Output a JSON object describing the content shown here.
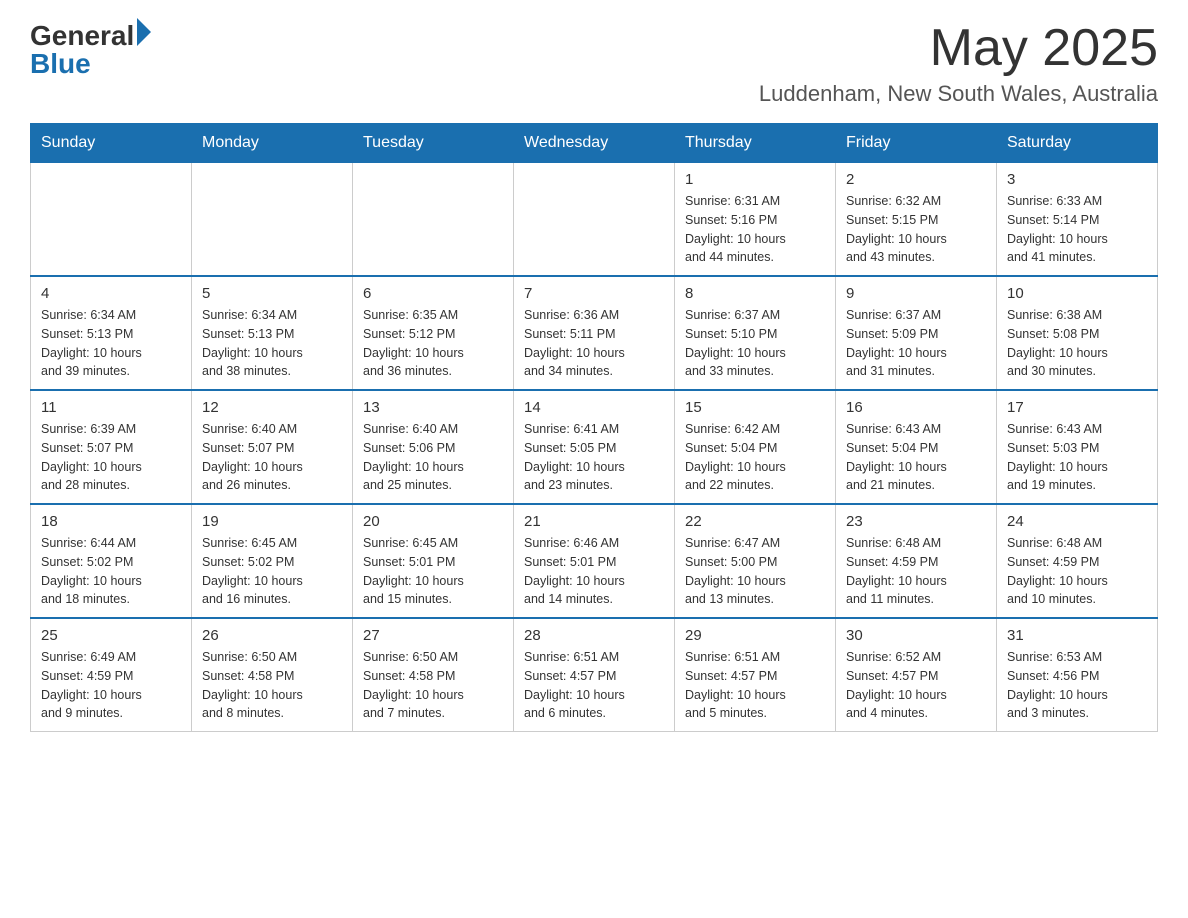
{
  "header": {
    "logo_general": "General",
    "logo_blue": "Blue",
    "month_title": "May 2025",
    "location": "Luddenham, New South Wales, Australia"
  },
  "calendar": {
    "days_of_week": [
      "Sunday",
      "Monday",
      "Tuesday",
      "Wednesday",
      "Thursday",
      "Friday",
      "Saturday"
    ],
    "weeks": [
      [
        {
          "day": "",
          "info": ""
        },
        {
          "day": "",
          "info": ""
        },
        {
          "day": "",
          "info": ""
        },
        {
          "day": "",
          "info": ""
        },
        {
          "day": "1",
          "info": "Sunrise: 6:31 AM\nSunset: 5:16 PM\nDaylight: 10 hours\nand 44 minutes."
        },
        {
          "day": "2",
          "info": "Sunrise: 6:32 AM\nSunset: 5:15 PM\nDaylight: 10 hours\nand 43 minutes."
        },
        {
          "day": "3",
          "info": "Sunrise: 6:33 AM\nSunset: 5:14 PM\nDaylight: 10 hours\nand 41 minutes."
        }
      ],
      [
        {
          "day": "4",
          "info": "Sunrise: 6:34 AM\nSunset: 5:13 PM\nDaylight: 10 hours\nand 39 minutes."
        },
        {
          "day": "5",
          "info": "Sunrise: 6:34 AM\nSunset: 5:13 PM\nDaylight: 10 hours\nand 38 minutes."
        },
        {
          "day": "6",
          "info": "Sunrise: 6:35 AM\nSunset: 5:12 PM\nDaylight: 10 hours\nand 36 minutes."
        },
        {
          "day": "7",
          "info": "Sunrise: 6:36 AM\nSunset: 5:11 PM\nDaylight: 10 hours\nand 34 minutes."
        },
        {
          "day": "8",
          "info": "Sunrise: 6:37 AM\nSunset: 5:10 PM\nDaylight: 10 hours\nand 33 minutes."
        },
        {
          "day": "9",
          "info": "Sunrise: 6:37 AM\nSunset: 5:09 PM\nDaylight: 10 hours\nand 31 minutes."
        },
        {
          "day": "10",
          "info": "Sunrise: 6:38 AM\nSunset: 5:08 PM\nDaylight: 10 hours\nand 30 minutes."
        }
      ],
      [
        {
          "day": "11",
          "info": "Sunrise: 6:39 AM\nSunset: 5:07 PM\nDaylight: 10 hours\nand 28 minutes."
        },
        {
          "day": "12",
          "info": "Sunrise: 6:40 AM\nSunset: 5:07 PM\nDaylight: 10 hours\nand 26 minutes."
        },
        {
          "day": "13",
          "info": "Sunrise: 6:40 AM\nSunset: 5:06 PM\nDaylight: 10 hours\nand 25 minutes."
        },
        {
          "day": "14",
          "info": "Sunrise: 6:41 AM\nSunset: 5:05 PM\nDaylight: 10 hours\nand 23 minutes."
        },
        {
          "day": "15",
          "info": "Sunrise: 6:42 AM\nSunset: 5:04 PM\nDaylight: 10 hours\nand 22 minutes."
        },
        {
          "day": "16",
          "info": "Sunrise: 6:43 AM\nSunset: 5:04 PM\nDaylight: 10 hours\nand 21 minutes."
        },
        {
          "day": "17",
          "info": "Sunrise: 6:43 AM\nSunset: 5:03 PM\nDaylight: 10 hours\nand 19 minutes."
        }
      ],
      [
        {
          "day": "18",
          "info": "Sunrise: 6:44 AM\nSunset: 5:02 PM\nDaylight: 10 hours\nand 18 minutes."
        },
        {
          "day": "19",
          "info": "Sunrise: 6:45 AM\nSunset: 5:02 PM\nDaylight: 10 hours\nand 16 minutes."
        },
        {
          "day": "20",
          "info": "Sunrise: 6:45 AM\nSunset: 5:01 PM\nDaylight: 10 hours\nand 15 minutes."
        },
        {
          "day": "21",
          "info": "Sunrise: 6:46 AM\nSunset: 5:01 PM\nDaylight: 10 hours\nand 14 minutes."
        },
        {
          "day": "22",
          "info": "Sunrise: 6:47 AM\nSunset: 5:00 PM\nDaylight: 10 hours\nand 13 minutes."
        },
        {
          "day": "23",
          "info": "Sunrise: 6:48 AM\nSunset: 4:59 PM\nDaylight: 10 hours\nand 11 minutes."
        },
        {
          "day": "24",
          "info": "Sunrise: 6:48 AM\nSunset: 4:59 PM\nDaylight: 10 hours\nand 10 minutes."
        }
      ],
      [
        {
          "day": "25",
          "info": "Sunrise: 6:49 AM\nSunset: 4:59 PM\nDaylight: 10 hours\nand 9 minutes."
        },
        {
          "day": "26",
          "info": "Sunrise: 6:50 AM\nSunset: 4:58 PM\nDaylight: 10 hours\nand 8 minutes."
        },
        {
          "day": "27",
          "info": "Sunrise: 6:50 AM\nSunset: 4:58 PM\nDaylight: 10 hours\nand 7 minutes."
        },
        {
          "day": "28",
          "info": "Sunrise: 6:51 AM\nSunset: 4:57 PM\nDaylight: 10 hours\nand 6 minutes."
        },
        {
          "day": "29",
          "info": "Sunrise: 6:51 AM\nSunset: 4:57 PM\nDaylight: 10 hours\nand 5 minutes."
        },
        {
          "day": "30",
          "info": "Sunrise: 6:52 AM\nSunset: 4:57 PM\nDaylight: 10 hours\nand 4 minutes."
        },
        {
          "day": "31",
          "info": "Sunrise: 6:53 AM\nSunset: 4:56 PM\nDaylight: 10 hours\nand 3 minutes."
        }
      ]
    ]
  }
}
